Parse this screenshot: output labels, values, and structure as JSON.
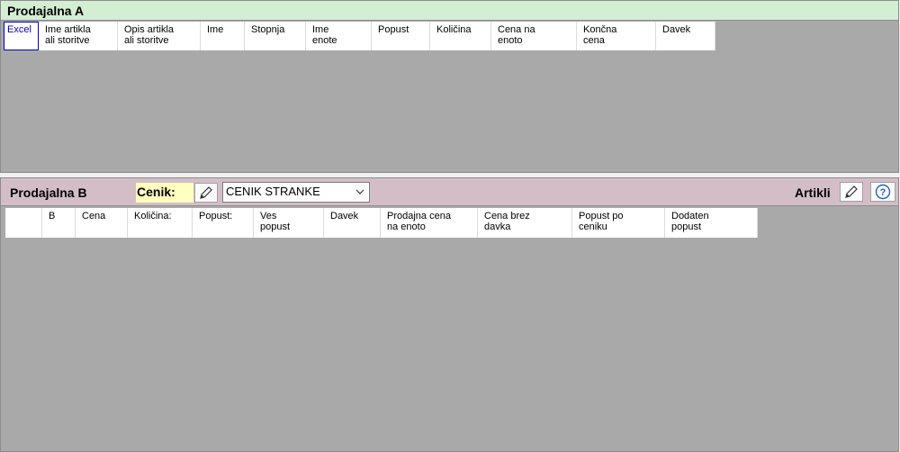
{
  "panel_a": {
    "title": "Prodajalna A",
    "columns": [
      {
        "label": "Excel"
      },
      {
        "label": "Ime artikla\nali storitve"
      },
      {
        "label": "Opis artikla\nali storitve"
      },
      {
        "label": "Ime"
      },
      {
        "label": "Stopnja"
      },
      {
        "label": "Ime\nenote"
      },
      {
        "label": "Popust"
      },
      {
        "label": "Količina"
      },
      {
        "label": "Cena na\nenoto"
      },
      {
        "label": "Končna\ncena"
      },
      {
        "label": "Davek"
      }
    ]
  },
  "panel_b": {
    "title": "Prodajalna B",
    "cenik_label": "Cenik:",
    "cenik_value": "CENIK STRANKE",
    "artikli_label": "Artikli",
    "columns": [
      {
        "label": ""
      },
      {
        "label": "B"
      },
      {
        "label": "Cena"
      },
      {
        "label": "Količina:"
      },
      {
        "label": "Popust:"
      },
      {
        "label": "Ves\npopust"
      },
      {
        "label": "Davek"
      },
      {
        "label": "Prodajna cena\nna enoto"
      },
      {
        "label": "Cena brez\ndavka"
      },
      {
        "label": "Popust po\nceniku"
      },
      {
        "label": "Dodaten\npopust"
      }
    ]
  },
  "colors": {
    "panel_a_header": "#d4eed4",
    "panel_b_header": "#d3bec8",
    "cenik_highlight": "#ffffc0",
    "grid_empty": "#a9a9a9"
  },
  "icons": {
    "edit": "pencil-icon",
    "help": "question-icon",
    "dropdown": "chevron-down-icon"
  }
}
